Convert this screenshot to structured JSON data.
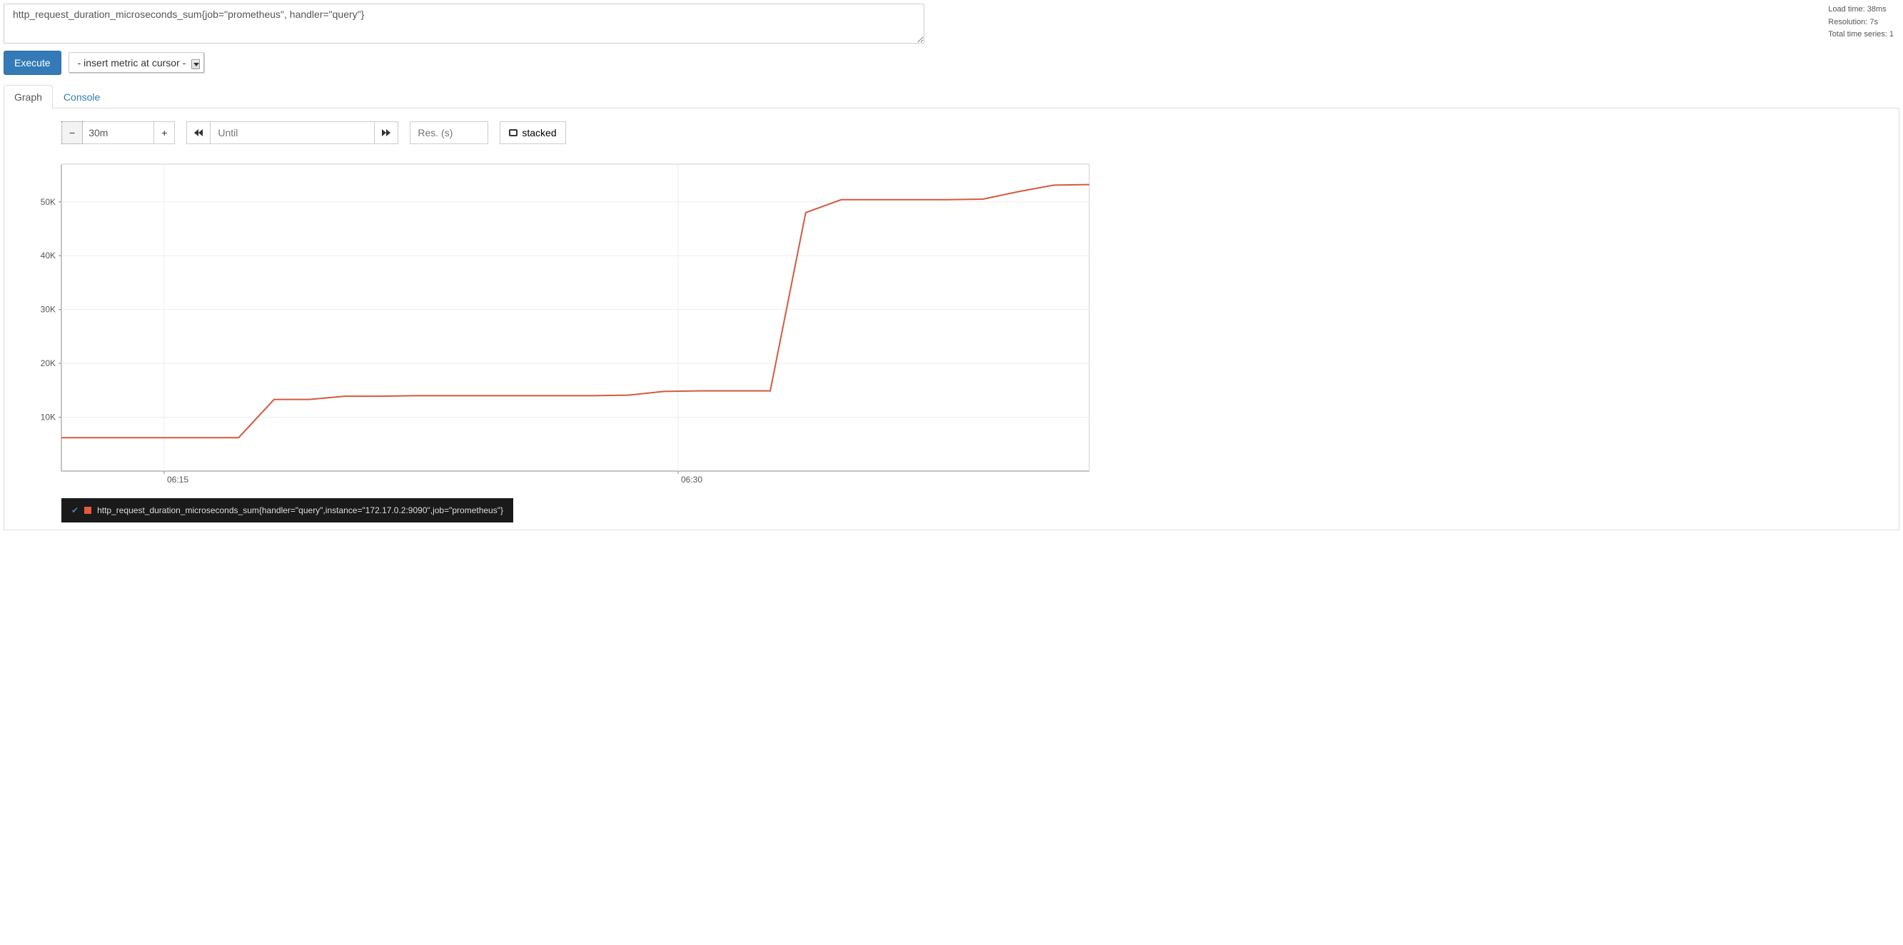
{
  "query": {
    "expression": "http_request_duration_microseconds_sum{job=\"prometheus\", handler=\"query\"}"
  },
  "stats": {
    "load_time": "Load time: 38ms",
    "resolution": "Resolution: 7s",
    "total_series": "Total time series: 1"
  },
  "exec": {
    "execute_label": "Execute",
    "metric_select": "- insert metric at cursor -"
  },
  "tabs": {
    "graph": "Graph",
    "console": "Console"
  },
  "controls": {
    "minus": "−",
    "plus": "+",
    "range": "30m",
    "until_placeholder": "Until",
    "res_placeholder": "Res. (s)",
    "stacked": "stacked"
  },
  "legend": {
    "series_label": "http_request_duration_microseconds_sum{handler=\"query\",instance=\"172.17.0.2:9090\",job=\"prometheus\"}"
  },
  "chart_data": {
    "type": "line",
    "xlabel": "",
    "ylabel": "",
    "ylim": [
      0,
      57000
    ],
    "x_ticks": [
      "06:15",
      "06:30"
    ],
    "y_ticks": [
      10000,
      20000,
      30000,
      40000,
      50000
    ],
    "y_tick_labels": [
      "10K",
      "20K",
      "30K",
      "40K",
      "50K"
    ],
    "series": [
      {
        "name": "http_request_duration_microseconds_sum",
        "color": "#d35a3f",
        "x": [
          0,
          1,
          2,
          3,
          4,
          5,
          6,
          7,
          8,
          9,
          10,
          11,
          12,
          13,
          14,
          15,
          16,
          17,
          18,
          19,
          20,
          21,
          22,
          23,
          24,
          25,
          26,
          27,
          28,
          29
        ],
        "values": [
          6200,
          6200,
          6200,
          6200,
          6200,
          6200,
          13300,
          13300,
          13900,
          13900,
          14000,
          14000,
          14000,
          14000,
          14000,
          14000,
          14100,
          14800,
          14900,
          14900,
          14900,
          48000,
          50400,
          50400,
          50400,
          50400,
          50500,
          51900,
          53100,
          53200
        ]
      }
    ]
  }
}
